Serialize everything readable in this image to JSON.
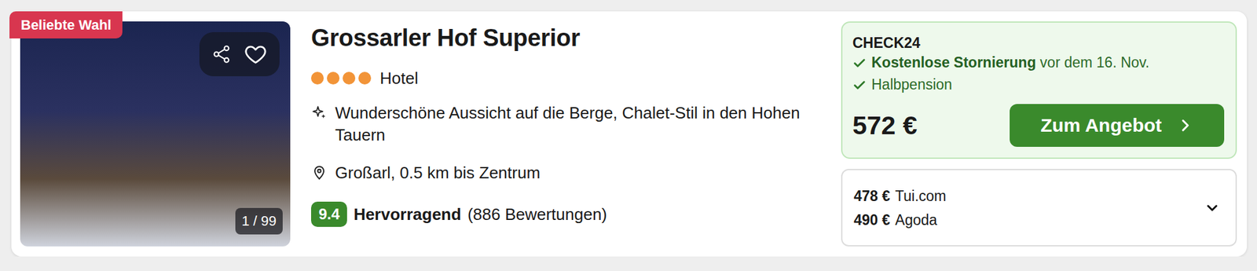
{
  "hotel": {
    "badge": "Beliebte Wahl",
    "image_counter": "1 / 99",
    "favorite": false,
    "title": "Grossarler Hof Superior",
    "stars": 4,
    "type": "Hotel",
    "highlight": "Wunderschöne Aussicht auf die Berge, Chalet-Stil in den Hohen Tauern",
    "location": "Großarl, 0.5 km bis Zentrum",
    "rating": {
      "score": "9.4",
      "label": "Hervorragend",
      "reviews": "(886 Bewertungen)"
    }
  },
  "offer": {
    "provider": "CHECK24",
    "features": [
      {
        "highlight": "Kostenlose Stornierung",
        "text": "vor dem 16. Nov."
      },
      {
        "highlight": "",
        "text": "Halbpension"
      }
    ],
    "price": "572 €",
    "button": "Zum Angebot"
  },
  "other_offers": [
    {
      "price": "478 €",
      "provider": "Tui.com"
    },
    {
      "price": "490 €",
      "provider": "Agoda"
    }
  ]
}
